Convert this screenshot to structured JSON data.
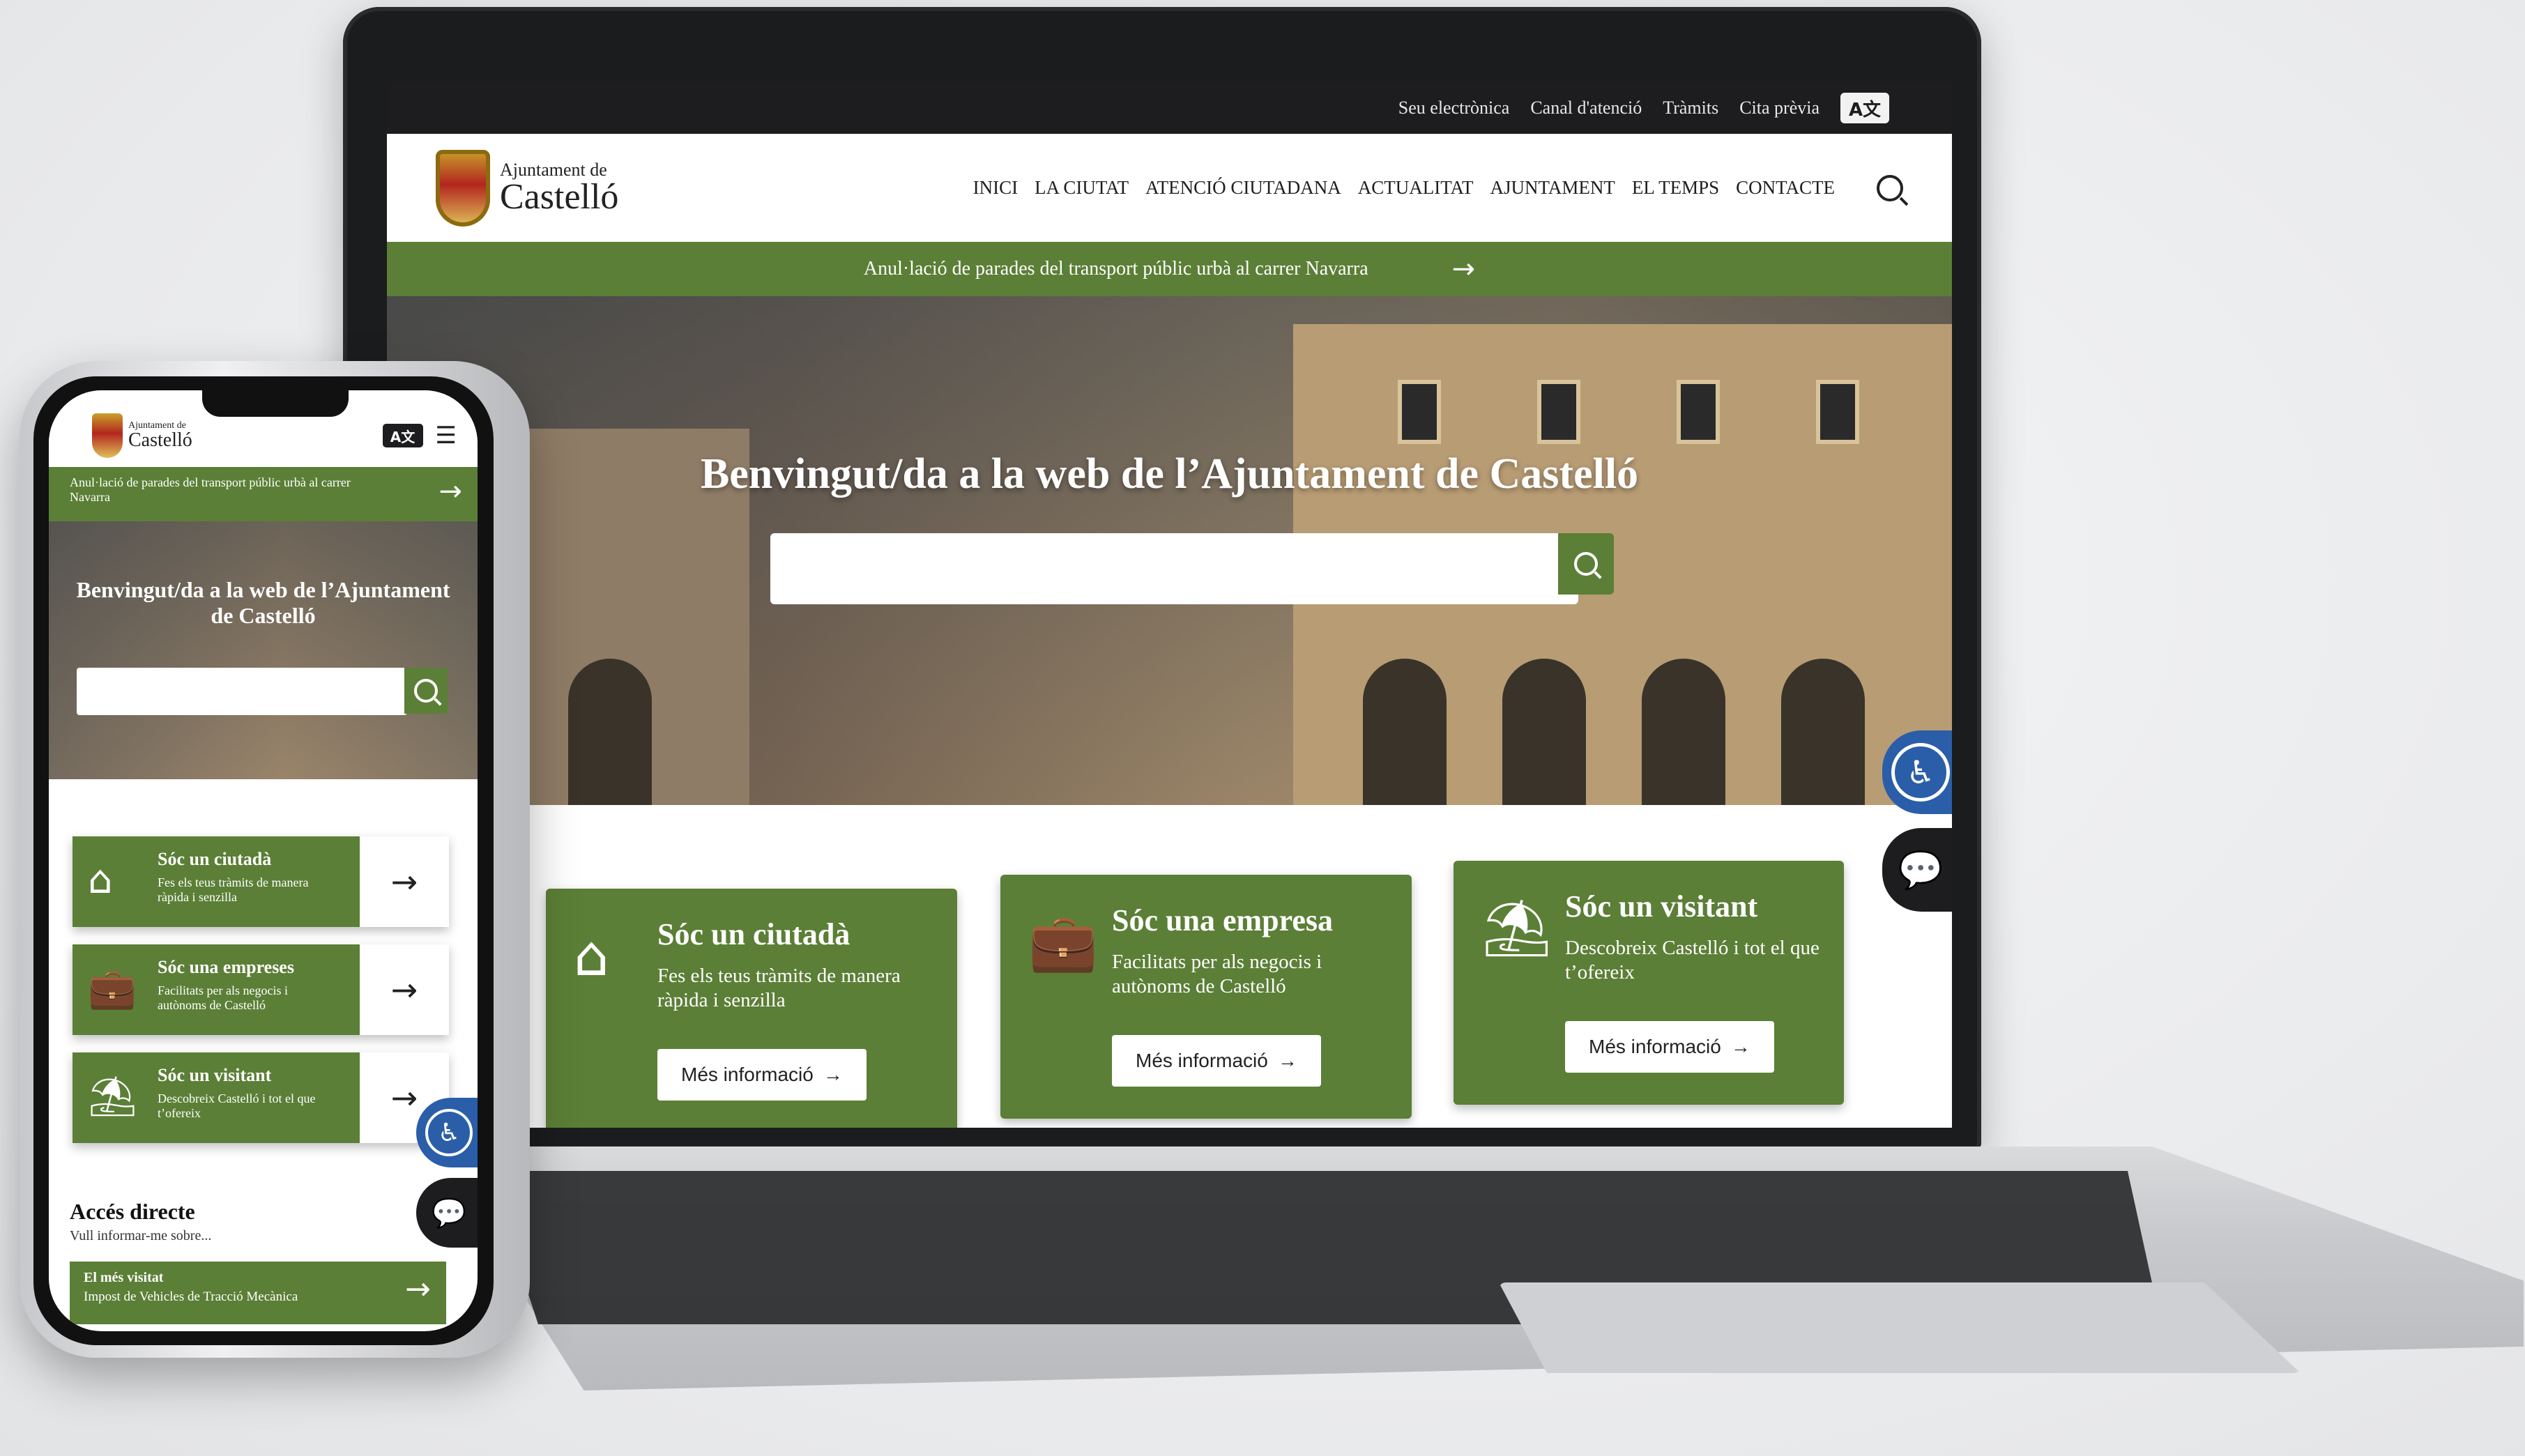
{
  "desktop": {
    "topbar": {
      "links": [
        "Seu electrònica",
        "Canal d'atenció",
        "Tràmits",
        "Cita prèvia"
      ],
      "lang_label": "A文"
    },
    "brand": {
      "small": "Ajuntament de",
      "big": "Castelló"
    },
    "nav": [
      "INICI",
      "LA CIUTAT",
      "ATENCIÓ CIUTADANA",
      "ACTUALITAT",
      "AJUNTAMENT",
      "EL TEMPS",
      "CONTACTE"
    ],
    "alert": {
      "text": "Anul·lació de parades del transport públic urbà al carrer Navarra",
      "arrow": "→"
    },
    "hero": {
      "title": "Benvingut/da a la web de l’Ajuntament de Castelló",
      "search_placeholder": ""
    },
    "cards": [
      {
        "icon": "⌂",
        "title": "Sóc un ciutadà",
        "desc": "Fes els teus tràmits de manera ràpida i senzilla",
        "button": "Més informació",
        "arrow": "→"
      },
      {
        "icon": "💼",
        "title": "Sóc una empresa",
        "desc": "Facilitats per als negocis i autònoms de Castelló",
        "button": "Més informació",
        "arrow": "→"
      },
      {
        "icon": "⛱",
        "title": "Sóc un visitant",
        "desc": "Descobreix Castelló i tot el que t’ofereix",
        "button": "Més informació",
        "arrow": "→"
      }
    ],
    "accessibility_icon": "♿",
    "chat_icon": "💬"
  },
  "mobile": {
    "brand": {
      "small": "Ajuntament de",
      "big": "Castelló"
    },
    "lang_label": "A文",
    "menu_icon": "☰",
    "alert": {
      "text": "Anul·lació de parades del transport públic urbà al carrer Navarra",
      "arrow": "→"
    },
    "hero": {
      "title": "Benvingut/da a la web de l’Ajuntament de Castelló",
      "search_placeholder": ""
    },
    "cards": [
      {
        "icon": "⌂",
        "title": "Sóc un ciutadà",
        "desc": "Fes els teus tràmits de manera ràpida i senzilla",
        "arrow": "→"
      },
      {
        "icon": "💼",
        "title": "Sóc una empreses",
        "desc": "Facilitats per als negocis i autònoms de Castelló",
        "arrow": "→"
      },
      {
        "icon": "⛱",
        "title": "Sóc un visitant",
        "desc": "Descobreix Castelló i tot el que t’ofereix",
        "arrow": "→"
      }
    ],
    "quick_access": {
      "title": "Accés directe",
      "subtitle": "Vull informar-me sobre...",
      "card_title": "El més visitat",
      "card_desc": "Impost de Vehicles de Tracció Mecànica",
      "arrow": "→"
    },
    "accessibility_icon": "♿",
    "chat_icon": "💬"
  },
  "colors": {
    "brand_green": "#5b7f36",
    "dark": "#1d1d1f",
    "accessibility_blue": "#2a5ea8"
  }
}
